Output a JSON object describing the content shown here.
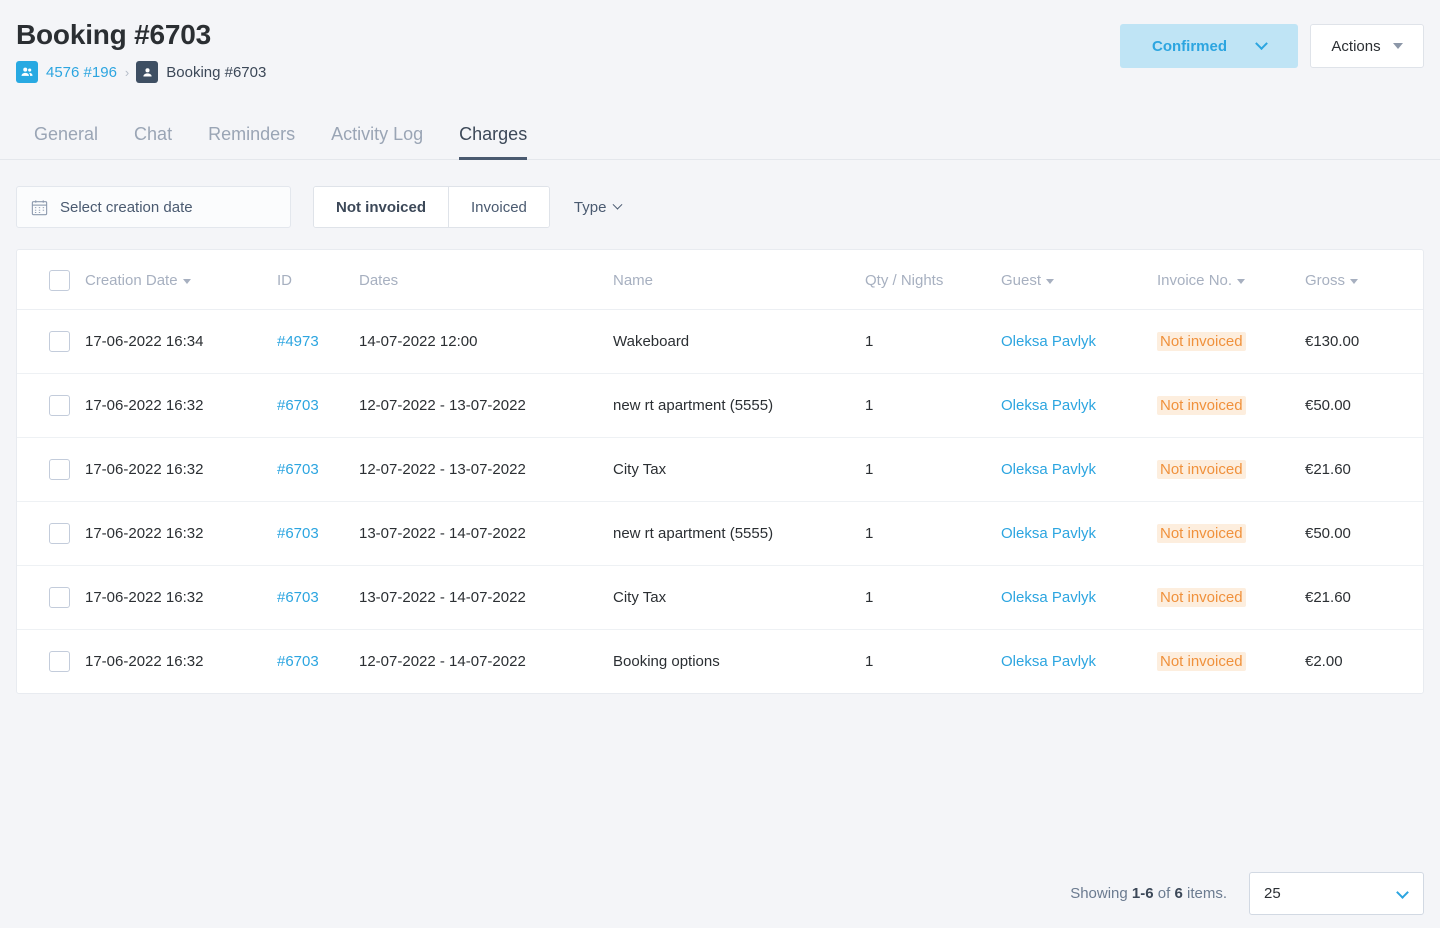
{
  "header": {
    "title": "Booking #6703",
    "breadcrumb": {
      "parent_label": "4576 #196",
      "parent_icon": "users-icon",
      "separator": "›",
      "current_label": "Booking #6703",
      "current_icon": "user-icon"
    },
    "status_button": {
      "label": "Confirmed",
      "icon": "chevron-down-icon"
    },
    "actions_button": {
      "label": "Actions",
      "icon": "caret-down-icon"
    }
  },
  "tabs": [
    {
      "label": "General",
      "active": false
    },
    {
      "label": "Chat",
      "active": false
    },
    {
      "label": "Reminders",
      "active": false
    },
    {
      "label": "Activity Log",
      "active": false
    },
    {
      "label": "Charges",
      "active": true
    }
  ],
  "filters": {
    "date_picker": {
      "label": "Select creation date",
      "icon": "calendar-icon"
    },
    "segments": [
      {
        "label": "Not invoiced",
        "selected": true
      },
      {
        "label": "Invoiced",
        "selected": false
      }
    ],
    "type": {
      "label": "Type",
      "icon": "chevron-down-icon"
    }
  },
  "table": {
    "columns": [
      {
        "key": "check",
        "label": "",
        "sortable": false
      },
      {
        "key": "date",
        "label": "Creation Date",
        "sortable": true
      },
      {
        "key": "id",
        "label": "ID",
        "sortable": false
      },
      {
        "key": "dates",
        "label": "Dates",
        "sortable": false
      },
      {
        "key": "name",
        "label": "Name",
        "sortable": false
      },
      {
        "key": "qty",
        "label": "Qty / Nights",
        "sortable": false
      },
      {
        "key": "guest",
        "label": "Guest",
        "sortable": true
      },
      {
        "key": "inv",
        "label": "Invoice No.",
        "sortable": true
      },
      {
        "key": "gross",
        "label": "Gross",
        "sortable": true
      }
    ],
    "rows": [
      {
        "creation_date": "17-06-2022 16:34",
        "id": "#4973",
        "dates": "14-07-2022 12:00",
        "name": "Wakeboard",
        "qty": "1",
        "guest": "Oleksa Pavlyk",
        "invoice_no": "Not invoiced",
        "gross": "€130.00"
      },
      {
        "creation_date": "17-06-2022 16:32",
        "id": "#6703",
        "dates": "12-07-2022 - 13-07-2022",
        "name": "new rt apartment (5555)",
        "qty": "1",
        "guest": "Oleksa Pavlyk",
        "invoice_no": "Not invoiced",
        "gross": "€50.00"
      },
      {
        "creation_date": "17-06-2022 16:32",
        "id": "#6703",
        "dates": "12-07-2022 - 13-07-2022",
        "name": "City Tax",
        "qty": "1",
        "guest": "Oleksa Pavlyk",
        "invoice_no": "Not invoiced",
        "gross": "€21.60"
      },
      {
        "creation_date": "17-06-2022 16:32",
        "id": "#6703",
        "dates": "13-07-2022 - 14-07-2022",
        "name": "new rt apartment (5555)",
        "qty": "1",
        "guest": "Oleksa Pavlyk",
        "invoice_no": "Not invoiced",
        "gross": "€50.00"
      },
      {
        "creation_date": "17-06-2022 16:32",
        "id": "#6703",
        "dates": "13-07-2022 - 14-07-2022",
        "name": "City Tax",
        "qty": "1",
        "guest": "Oleksa Pavlyk",
        "invoice_no": "Not invoiced",
        "gross": "€21.60"
      },
      {
        "creation_date": "17-06-2022 16:32",
        "id": "#6703",
        "dates": "12-07-2022 - 14-07-2022",
        "name": "Booking options",
        "qty": "1",
        "guest": "Oleksa Pavlyk",
        "invoice_no": "Not invoiced",
        "gross": "€2.00"
      }
    ]
  },
  "footer": {
    "showing_prefix": "Showing ",
    "showing_range": "1-6",
    "showing_middle": " of ",
    "showing_total": "6",
    "showing_suffix": " items.",
    "per_page_value": "25",
    "per_page_icon": "chevron-down-icon"
  },
  "colors": {
    "page_bg": "#f4f5f8",
    "link_blue": "#2ca5e0",
    "status_bg": "#bfe4f5",
    "badge_orange_text": "#f0913c",
    "badge_orange_bg": "#fdeede",
    "tab_active": "#3c4858",
    "tab_inactive": "#9aa5b5",
    "header_text": "#a7b0c0"
  }
}
